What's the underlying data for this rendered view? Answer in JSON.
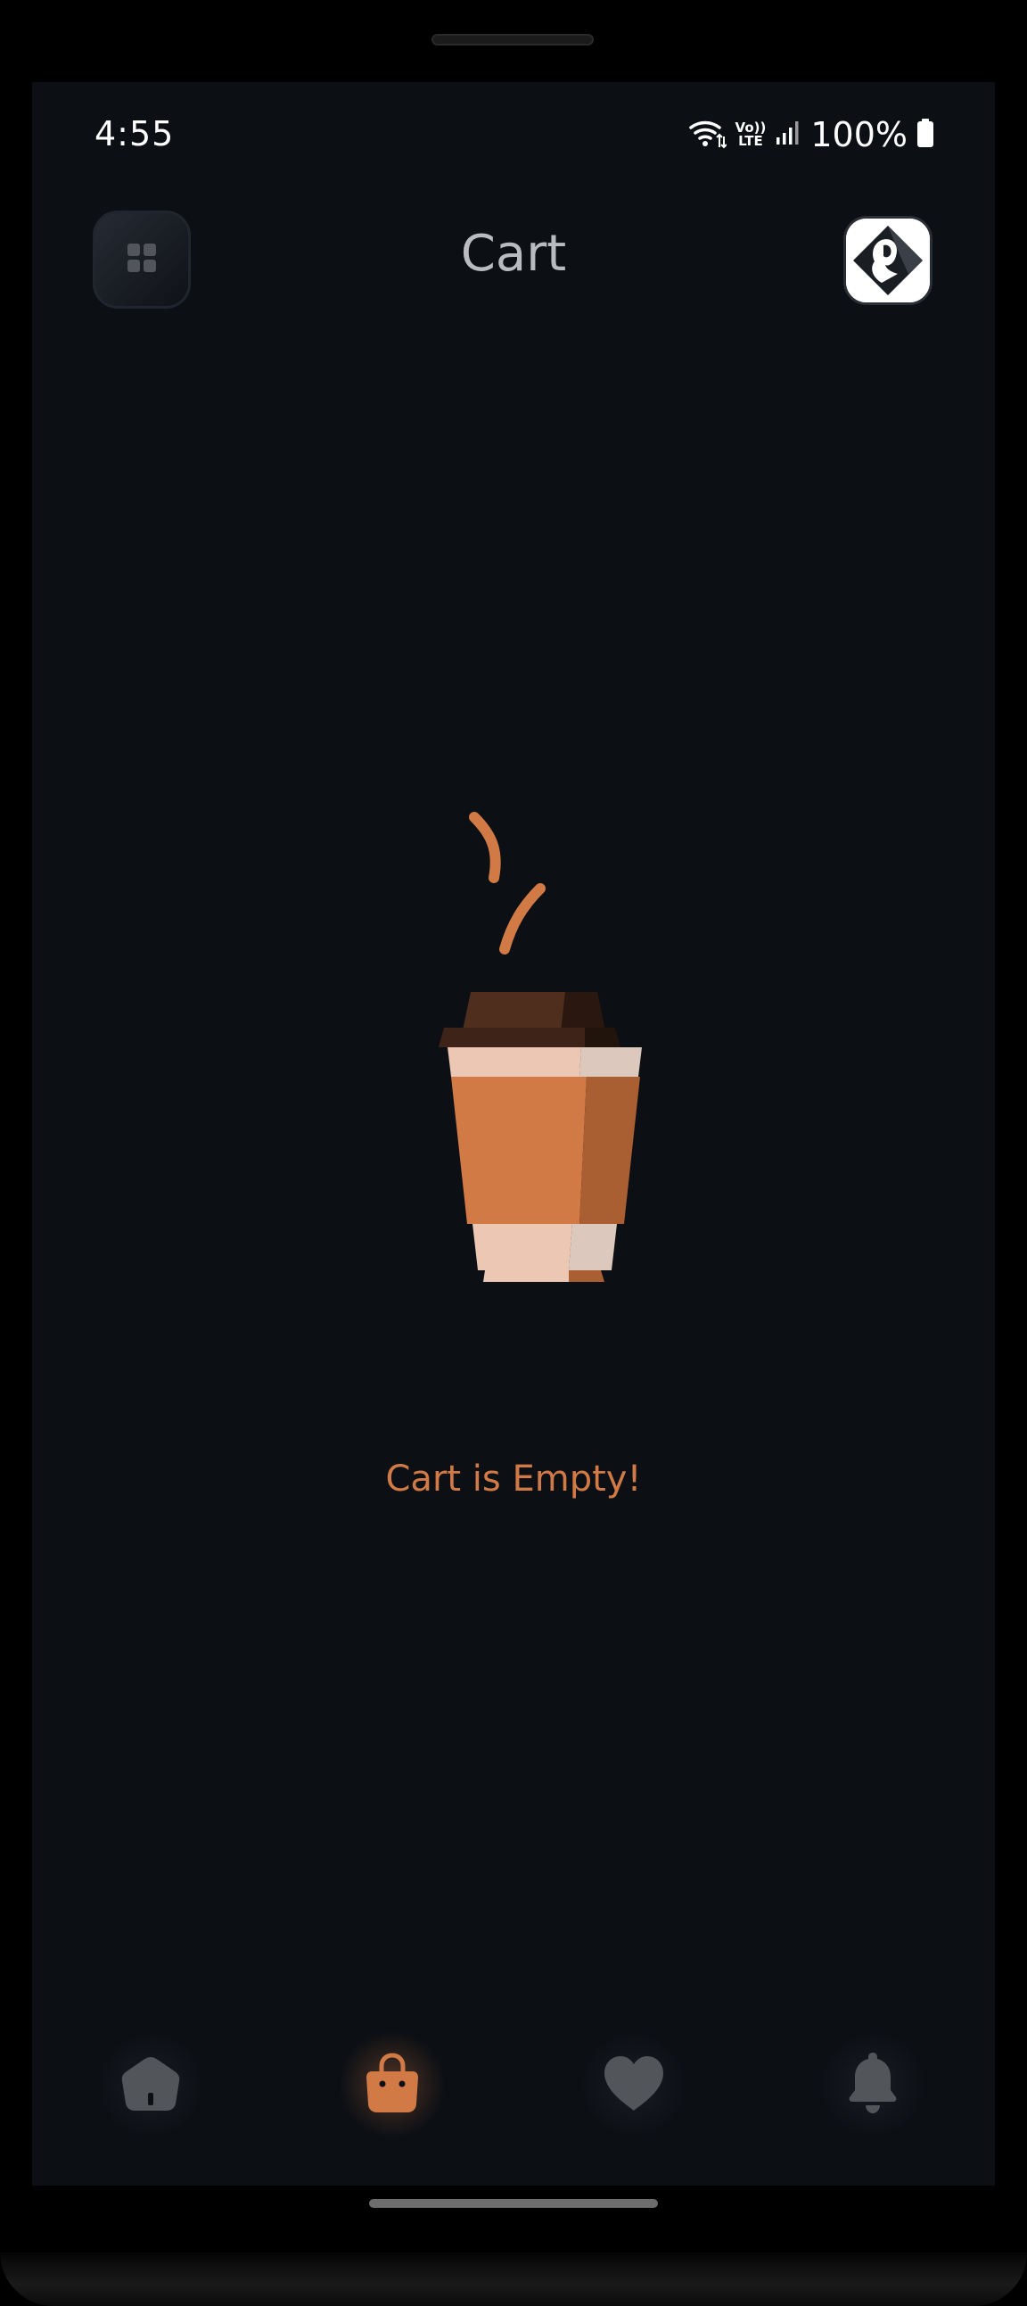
{
  "status_bar": {
    "time": "4:55",
    "battery": "100%",
    "network_label_top": "Vo))",
    "network_label_bottom": "LTE",
    "icons": [
      "wifi-icon",
      "volte-icon",
      "signal-icon",
      "battery-icon"
    ]
  },
  "header": {
    "title": "Cart",
    "menu_icon": "grid-icon",
    "avatar_icon": "avatar"
  },
  "empty_state": {
    "message": "Cart is Empty!",
    "illustration": "coffee-cup-icon"
  },
  "bottom_nav": {
    "items": [
      {
        "name": "home",
        "icon": "home-icon",
        "active": false
      },
      {
        "name": "cart",
        "icon": "shopping-bag-icon",
        "active": true
      },
      {
        "name": "favorites",
        "icon": "heart-icon",
        "active": false
      },
      {
        "name": "notifications",
        "icon": "bell-icon",
        "active": false
      }
    ]
  },
  "colors": {
    "background": "#0c0f14",
    "accent": "#d17a45",
    "inactive_icon": "#52555a",
    "title_text": "#b9bbbf"
  }
}
